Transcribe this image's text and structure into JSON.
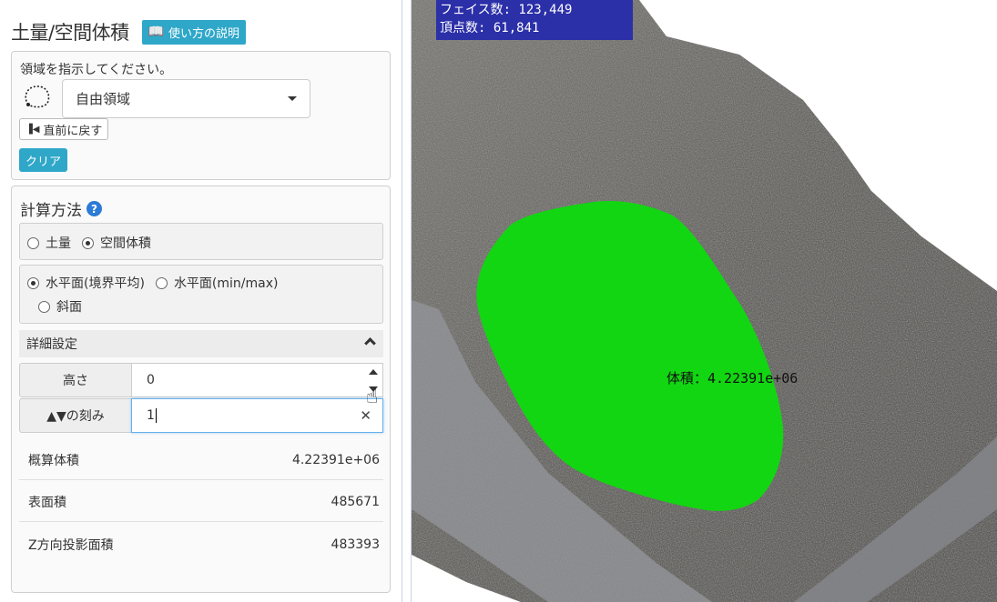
{
  "header": {
    "title": "土量/空間体積",
    "help_label": "使い方の説明"
  },
  "region": {
    "instruction": "領域を指示してください。",
    "mode_value": "自由領域",
    "undo_label": "直前に戻す",
    "clear_label": "クリア"
  },
  "calc": {
    "title": "計算方法",
    "method_options": [
      {
        "label": "土量",
        "selected": false
      },
      {
        "label": "空間体積",
        "selected": true
      }
    ],
    "plane_options": [
      {
        "label": "水平面(境界平均)",
        "selected": true
      },
      {
        "label": "水平面(min/max)",
        "selected": false
      },
      {
        "label": "斜面",
        "selected": false
      }
    ],
    "detail_label": "詳細設定",
    "height_label": "高さ",
    "height_value": "0",
    "step_label": "▲▼の刻み",
    "step_value": "1"
  },
  "results": [
    {
      "label": "概算体積",
      "value": "4.22391e+06"
    },
    {
      "label": "表面積",
      "value": "485671"
    },
    {
      "label": "Z方向投影面積",
      "value": "483393"
    }
  ],
  "viewport": {
    "faces_text": "フェイス数: 123,449",
    "vertices_text": "頂点数: 61,841",
    "volume_text": "体積：4.22391e+06",
    "region_color": "#12d612"
  }
}
